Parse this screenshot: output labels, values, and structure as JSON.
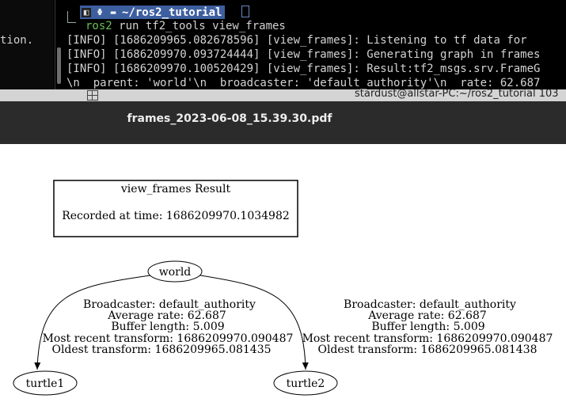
{
  "terminal": {
    "left_fragment": "tion.",
    "prompt_path": "~/ros2_tutorial",
    "command_keyword": "ros2",
    "command_rest": " run tf2_tools view_frames",
    "log_lines": [
      "[INFO] [1686209965.082678596] [view_frames]: Listening to tf data for",
      "[INFO] [1686209970.093724444] [view_frames]: Generating graph in frames",
      "[INFO] [1686209970.100520429] [view_frames]: Result:tf2_msgs.srv.FrameG",
      "\\n  parent: 'world'\\n  broadcaster: 'default_authority'\\n  rate: 62.687"
    ]
  },
  "status_strip": {
    "user_host": "stardust@allstar-PC:~/ros2_tutorial 103"
  },
  "viewer": {
    "title": "frames_2023-06-08_15.39.30.pdf"
  },
  "graph": {
    "result_box": {
      "title": "view_frames Result",
      "recorded": "Recorded at time: 1686209970.1034982"
    },
    "nodes": {
      "world": "world",
      "turtle1": "turtle1",
      "turtle2": "turtle2"
    },
    "edge1": {
      "broadcaster": "Broadcaster: default_authority",
      "rate": "Average rate: 62.687",
      "buffer": "Buffer length: 5.009",
      "recent": "Most recent transform: 1686209970.090487",
      "oldest": "Oldest transform: 1686209965.081435"
    },
    "edge2": {
      "broadcaster": "Broadcaster: default_authority",
      "rate": "Average rate: 62.687",
      "buffer": "Buffer length: 5.009",
      "recent": "Most recent transform: 1686209970.090487",
      "oldest": "Oldest transform: 1686209965.081438"
    }
  }
}
